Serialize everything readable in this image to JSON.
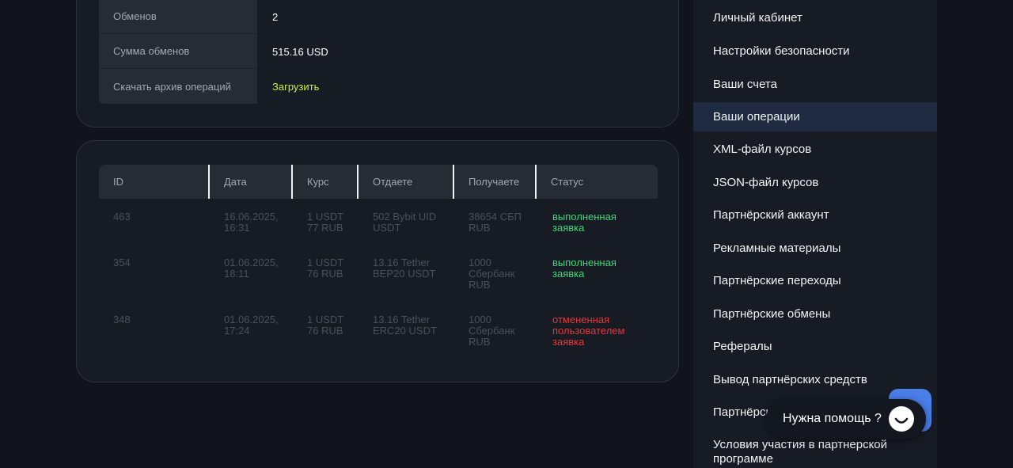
{
  "summary": {
    "rows": [
      {
        "label": "Обменов",
        "value": "2"
      },
      {
        "label": "Сумма обменов",
        "value": "515.16 USD"
      },
      {
        "label": "Скачать архив операций",
        "value": "Загрузить"
      }
    ]
  },
  "operations": {
    "headers": [
      "ID",
      "Дата",
      "Курс",
      "Отдаете",
      "Получаете",
      "Статус"
    ],
    "rows": [
      {
        "id": "463",
        "date": "16.06.2025,\n16:31",
        "rate": "1 USDT\n77 RUB",
        "give": "502 Bybit UID\nUSDT",
        "get": "38654 СБП\nRUB",
        "status": "выполненная\nзаявка"
      },
      {
        "id": "354",
        "date": "01.06.2025,\n18:11",
        "rate": "1 USDT\n76 RUB",
        "give": "13.16 Tether\nBEP20 USDT",
        "get": "1000\nСбербанк\nRUB",
        "status": "выполненная\nзаявка"
      },
      {
        "id": "348",
        "date": "01.06.2025,\n17:24",
        "rate": "1 USDT\n76 RUB",
        "give": "13.16 Tether\nERC20 USDT",
        "get": "1000\nСбербанк\nRUB",
        "status": "отмененная\nпользователем\nзаявка"
      }
    ]
  },
  "sidebar": {
    "items": [
      {
        "label": "Личный кабинет"
      },
      {
        "label": "Настройки безопасности"
      },
      {
        "label": "Ваши счета"
      },
      {
        "label": "Ваши операции"
      },
      {
        "label": "XML-файл курсов"
      },
      {
        "label": "JSON-файл курсов"
      },
      {
        "label": "Партнёрский аккаунт"
      },
      {
        "label": "Рекламные материалы"
      },
      {
        "label": "Партнёрские переходы"
      },
      {
        "label": "Партнёрские обмены"
      },
      {
        "label": "Рефералы"
      },
      {
        "label": "Вывод партнёрских средств"
      },
      {
        "label": "Партнёрск"
      },
      {
        "label": "Условия участия в партнерской программе"
      }
    ]
  },
  "help": {
    "label": "Нужна помощь ?",
    "icon": "chat-smile-icon"
  },
  "colors": {
    "background": "#11141c",
    "card": "#171b24",
    "accent_link": "#c8f03c",
    "status_done": "#3fd67a",
    "status_cancelled": "#e0393b",
    "active_nav": "#1e2a40",
    "help_blue": "#4a7ee8"
  }
}
